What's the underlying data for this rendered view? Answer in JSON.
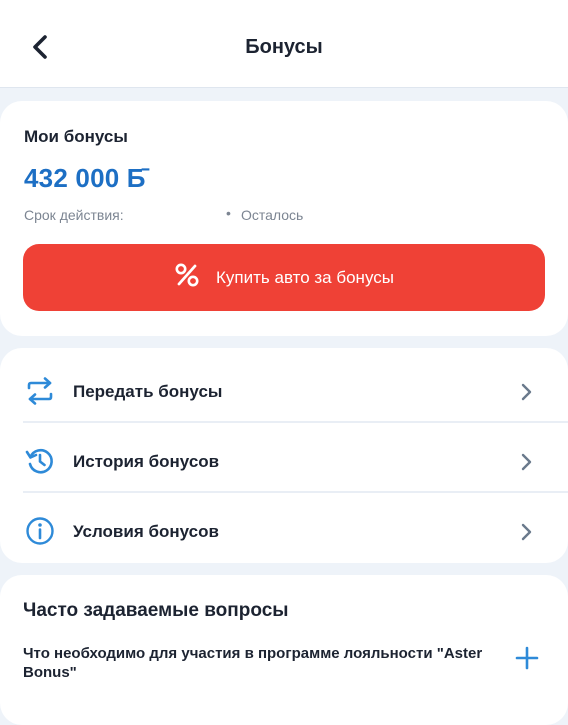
{
  "header": {
    "title": "Бонусы",
    "back_icon": "chevron-left-icon"
  },
  "balance": {
    "label": "Мои бонусы",
    "value": "432 000 Б̄",
    "validity_label": "Срок действия:",
    "dot": "•",
    "remaining_label": "Осталось",
    "accent_color": "#1d6fc4",
    "buy_button": {
      "label": "Купить авто за бонусы",
      "icon": "percent-icon",
      "color": "#ef4136"
    }
  },
  "menu": {
    "items": [
      {
        "label": "Передать бонусы",
        "icon": "transfer-arrows-icon"
      },
      {
        "label": "История бонусов",
        "icon": "history-icon"
      },
      {
        "label": "Условия бонусов",
        "icon": "info-icon"
      }
    ]
  },
  "faq": {
    "title": "Часто задаваемые вопросы",
    "items": [
      {
        "question": "Что необходимо для участия в программе лояльности \"Aster Bonus\"",
        "icon": "plus-icon"
      }
    ]
  }
}
